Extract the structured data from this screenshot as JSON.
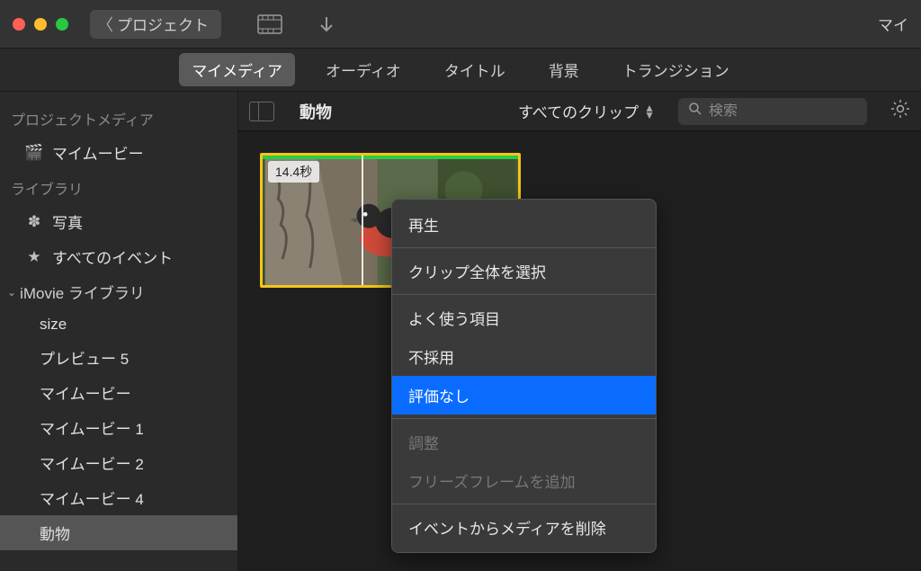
{
  "titlebar": {
    "back_label": "プロジェクト",
    "right_text": "マイ"
  },
  "tabs": {
    "my_media": "マイメディア",
    "audio": "オーディオ",
    "titles": "タイトル",
    "backgrounds": "背景",
    "transitions": "トランジション"
  },
  "sidebar": {
    "project_media_heading": "プロジェクトメディア",
    "my_movie": "マイムービー",
    "library_heading": "ライブラリ",
    "photos": "写真",
    "all_events": "すべてのイベント",
    "imovie_library": "iMovie ライブラリ",
    "children": {
      "size": "size",
      "preview5": "プレビュー 5",
      "mymovie": "マイムービー",
      "mymovie1": "マイムービー 1",
      "mymovie2": "マイムービー 2",
      "mymovie4": "マイムービー 4",
      "animals": "動物"
    }
  },
  "library_toolbar": {
    "title": "動物",
    "filter_label": "すべてのクリップ",
    "search_placeholder": "検索"
  },
  "clip": {
    "duration_label": "14.4秒"
  },
  "context_menu": {
    "play": "再生",
    "select_entire_clip": "クリップ全体を選択",
    "favorites": "よく使う項目",
    "reject": "不採用",
    "unrate": "評価なし",
    "adjust": "調整",
    "add_freeze_frame": "フリーズフレームを追加",
    "delete_from_event": "イベントからメディアを削除"
  }
}
